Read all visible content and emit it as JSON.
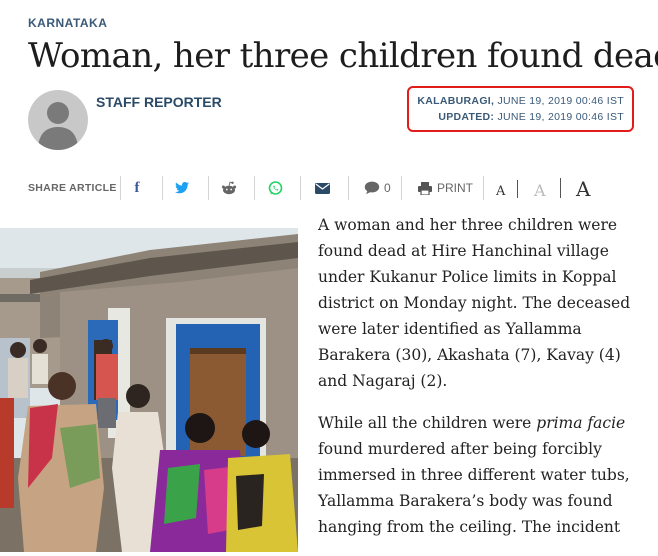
{
  "section": "KARNATAKA",
  "headline": "Woman, her three children found dead",
  "author": "STAFF REPORTER",
  "dateline": {
    "location": "KALABURAGI,",
    "published": "JUNE 19, 2019 00:46 IST",
    "updated_label": "UPDATED:",
    "updated": "JUNE 19, 2019 00:46 IST"
  },
  "share": {
    "label": "SHARE ARTICLE",
    "icons": [
      "facebook-icon",
      "twitter-icon",
      "reddit-icon",
      "whatsapp-icon",
      "email-icon",
      "comment-icon",
      "print-icon"
    ],
    "comment_count": "0",
    "print_label": "PRINT",
    "font_sizes": [
      "A",
      "A",
      "A"
    ]
  },
  "colors": {
    "accent": "#3a5a78",
    "highlight_border": "#e21b1b",
    "facebook": "#3b5998",
    "twitter": "#1da1f2",
    "whatsapp": "#25d366"
  },
  "article": {
    "p1": "A woman and her three children were found dead at Hire Hanchinal village under Kukanur Police limits in Koppal district on Monday night. The deceased were later identified as Yallamma Barakera (30), Akashata (7), Kavay (4) and Nagaraj (2).",
    "p2_before": "While all the children were ",
    "p2_em": "prima facie",
    "p2_after": " found murdered after being forcibly immersed in three different water tubs, Yallamma Barakera’s body was found hanging from the ceiling. The incident"
  }
}
